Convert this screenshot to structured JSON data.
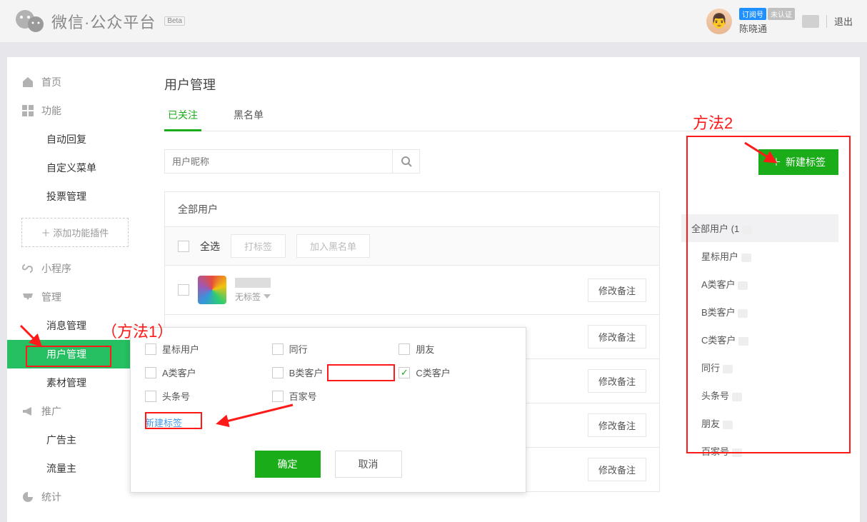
{
  "header": {
    "logo_text": "微信·公众平台",
    "beta": "Beta",
    "badge_blue": "订阅号",
    "badge_gray": "未认证",
    "username": "陈晓通",
    "logout": "退出"
  },
  "sidebar": {
    "home": "首页",
    "features": "功能",
    "auto_reply": "自动回复",
    "custom_menu": "自定义菜单",
    "vote_manage": "投票管理",
    "add_plugin": "添加功能插件",
    "miniapp": "小程序",
    "manage": "管理",
    "msg_manage": "消息管理",
    "user_manage": "用户管理",
    "material_manage": "素材管理",
    "promotion": "推广",
    "advertiser": "广告主",
    "traffic_master": "流量主",
    "stats": "统计"
  },
  "content": {
    "title": "用户管理",
    "tab_followed": "已关注",
    "tab_blacklist": "黑名单",
    "search_placeholder": "用户昵称",
    "all_users_header": "全部用户",
    "select_all": "全选",
    "tag_btn": "打标签",
    "blacklist_btn": "加入黑名单",
    "no_tag": "无标签",
    "edit_remark": "修改备注"
  },
  "tag_popup": {
    "tags": {
      "star": "星标用户",
      "peer": "同行",
      "friend": "朋友",
      "a_customer": "A类客户",
      "b_customer": "B类客户",
      "c_customer": "C类客户",
      "toutiao": "头条号",
      "baijia": "百家号"
    },
    "checked": "c_customer",
    "new_tag": "新建标签",
    "confirm": "确定",
    "cancel": "取消"
  },
  "right_panel": {
    "new_tag_btn": "新建标签",
    "items": [
      {
        "label": "全部用户",
        "count": "(1"
      },
      {
        "label": "星标用户",
        "count": ""
      },
      {
        "label": "A类客户",
        "count": ""
      },
      {
        "label": "B类客户",
        "count": ""
      },
      {
        "label": "C类客户",
        "count": ""
      },
      {
        "label": "同行",
        "count": ""
      },
      {
        "label": "头条号",
        "count": ""
      },
      {
        "label": "朋友",
        "count": ""
      },
      {
        "label": "百家号",
        "count": ""
      }
    ]
  },
  "annotations": {
    "method1": "（方法1）",
    "method2": "方法2"
  }
}
